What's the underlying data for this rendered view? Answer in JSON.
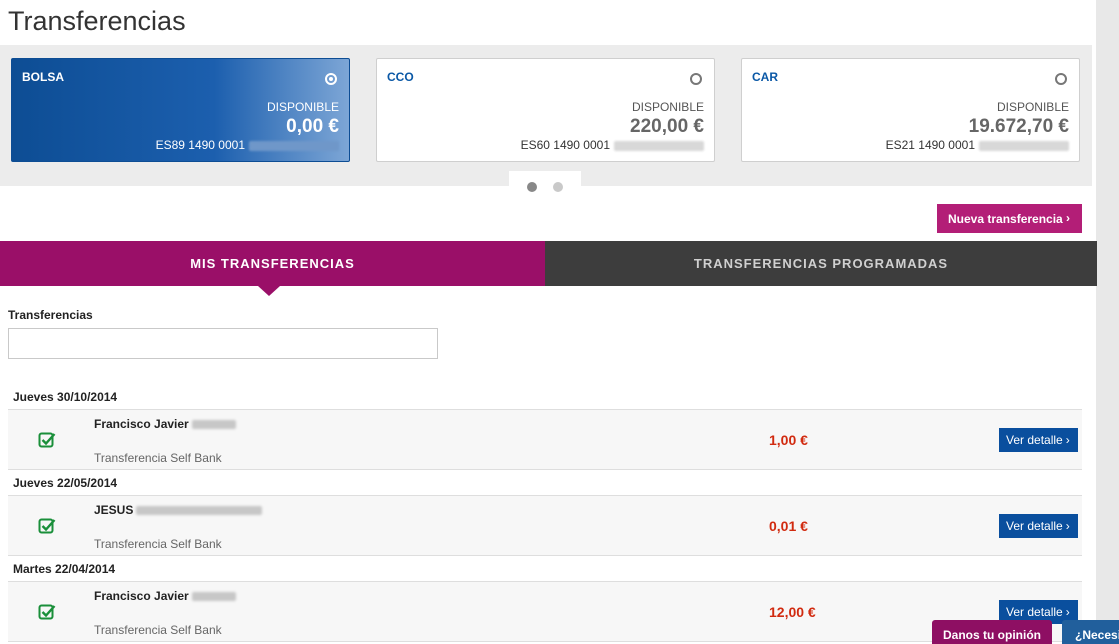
{
  "page": {
    "title": "Transferencias"
  },
  "accounts": [
    {
      "name": "BOLSA",
      "selected": true,
      "available_label": "DISPONIBLE",
      "amount": "0,00 €",
      "iban_prefix": "ES89 1490 0001"
    },
    {
      "name": "CCO",
      "selected": false,
      "available_label": "DISPONIBLE",
      "amount": "220,00 €",
      "iban_prefix": "ES60 1490 0001"
    },
    {
      "name": "CAR",
      "selected": false,
      "available_label": "DISPONIBLE",
      "amount": "19.672,70 €",
      "iban_prefix": "ES21 1490 0001"
    }
  ],
  "carousel": {
    "pages": 2,
    "current_page": 1
  },
  "actions": {
    "new_transfer_label": "Nueva transferencia"
  },
  "tabs": [
    {
      "label": "MIS TRANSFERENCIAS",
      "active": true
    },
    {
      "label": "TRANSFERENCIAS PROGRAMADAS",
      "active": false
    }
  ],
  "filter": {
    "label": "Transferencias",
    "value": ""
  },
  "transfers": [
    {
      "date": "Jueves 30/10/2014",
      "name": "Francisco Javier",
      "description": "Transferencia Self Bank",
      "amount": "1,00 €",
      "detail_label": "Ver detalle"
    },
    {
      "date": "Jueves 22/05/2014",
      "name": "JESUS",
      "description": "Transferencia Self Bank",
      "amount": "0,01 €",
      "detail_label": "Ver detalle"
    },
    {
      "date": "Martes 22/04/2014",
      "name": "Francisco Javier",
      "description": "Transferencia Self Bank",
      "amount": "12,00 €",
      "detail_label": "Ver detalle"
    }
  ],
  "footer": {
    "opinion_label": "Danos tu opinión",
    "help_label": "¿Necesi"
  },
  "colors": {
    "primary_blue": "#0a4f9e",
    "magenta": "#9a0f68",
    "dark_tab": "#3d3d3d",
    "amount_red": "#d12a0f"
  },
  "icons": {
    "transfer_status": "check-square-icon",
    "detail_chevron": "chevron-right-icon",
    "radio": "radio-icon"
  }
}
